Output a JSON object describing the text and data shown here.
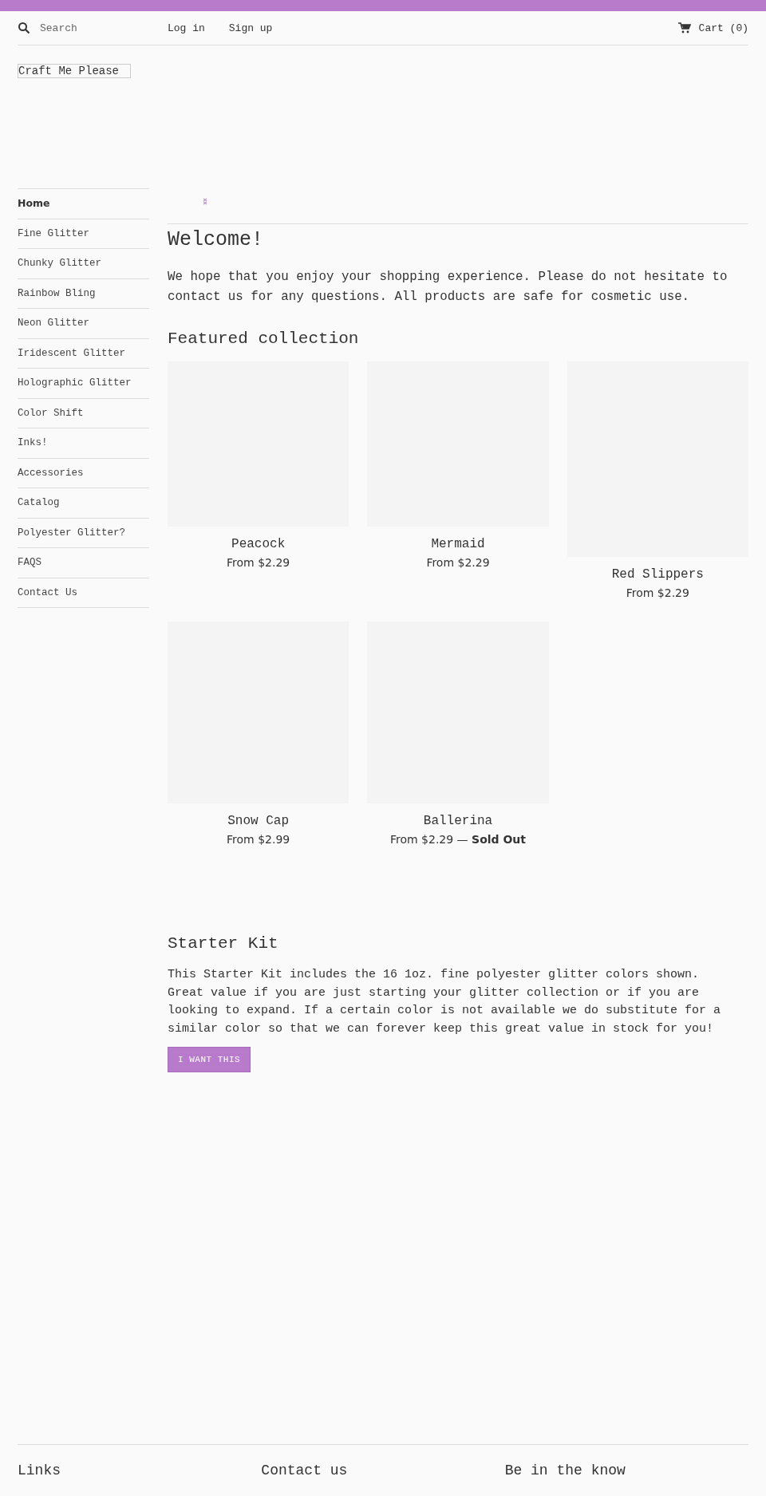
{
  "header": {
    "search": {
      "placeholder": "Search"
    },
    "links": [
      "Log in",
      "Sign up"
    ],
    "cart": "Cart (0)"
  },
  "logo": "Craft Me Please",
  "sidebar": {
    "items": [
      {
        "label": "Home",
        "selected": true
      },
      {
        "label": "Fine Glitter",
        "selected": false
      },
      {
        "label": "Chunky Glitter",
        "selected": false
      },
      {
        "label": "Rainbow Bling",
        "selected": false
      },
      {
        "label": "Neon Glitter",
        "selected": false
      },
      {
        "label": "Iridescent Glitter",
        "selected": false
      },
      {
        "label": "Holographic Glitter",
        "selected": false
      },
      {
        "label": "Color Shift",
        "selected": false
      },
      {
        "label": "Inks!",
        "selected": false
      },
      {
        "label": "Accessories",
        "selected": false
      },
      {
        "label": "Catalog",
        "selected": false
      },
      {
        "label": "Polyester Glitter?",
        "selected": false
      },
      {
        "label": "FAQS",
        "selected": false
      },
      {
        "label": "Contact Us",
        "selected": false
      }
    ]
  },
  "welcome": {
    "title": "Welcome!",
    "text": "We hope that you enjoy your shopping experience. Please do not hesitate to contact us for any questions. All products are safe for cosmetic use."
  },
  "featured": {
    "title": "Featured collection",
    "products": [
      {
        "kind": "landscape",
        "name": "Peacock",
        "price": "From $2.29"
      },
      {
        "kind": "landscape",
        "name": "Mermaid",
        "price": "From $2.29"
      },
      {
        "kind": "portrait",
        "name": "Red Slippers",
        "price": "From $2.29"
      },
      {
        "kind": "square",
        "name": "Snow Cap",
        "price": "From $2.99"
      },
      {
        "kind": "square",
        "name": "Ballerina",
        "price": "From $2.29 — **Sold Out**"
      }
    ]
  },
  "starter_kit": {
    "title": "Starter Kit",
    "text": "This Starter Kit includes the 16 1oz. fine polyester glitter colors shown. Great value if you are just starting your glitter collection or if you are looking to expand. If a certain color is not available we do substitute for a similar color so that we can forever keep this great value in stock for you!",
    "button": "I WANT THIS"
  },
  "footer": {
    "columns": [
      "Links",
      "Contact us",
      "Be in the know"
    ]
  }
}
